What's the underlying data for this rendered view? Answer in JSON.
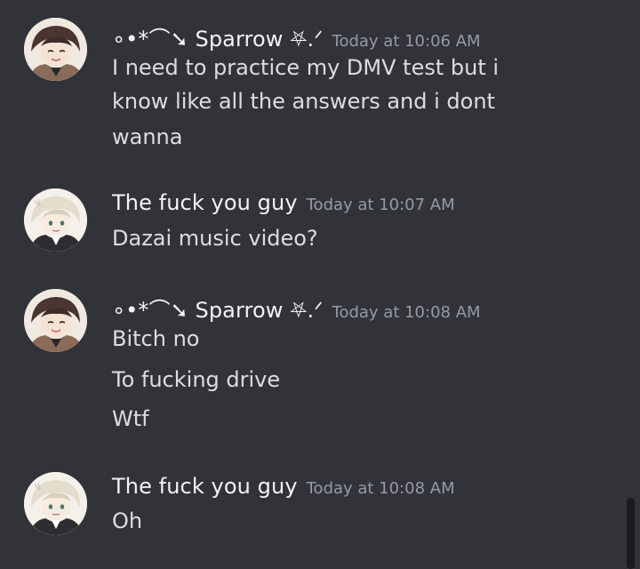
{
  "messages": [
    {
      "username": "∘•*⌒➘ Sparrow ⛧.ᐟ",
      "timestamp": "Today at 10:06 AM",
      "avatar_icon": "anime-avatar-brown-hair",
      "lines": [
        "I need to practice my DMV test but i",
        "know like all the answers and i dont",
        "wanna"
      ]
    },
    {
      "username": "The fuck you guy",
      "timestamp": "Today at 10:07 AM",
      "avatar_icon": "anime-avatar-light-hair",
      "lines": [
        "Dazai music video?"
      ]
    },
    {
      "username": "∘•*⌒➘ Sparrow ⛧.ᐟ",
      "timestamp": "Today at 10:08 AM",
      "avatar_icon": "anime-avatar-brown-hair",
      "lines": [
        "Bitch no",
        "To fucking drive",
        "Wtf"
      ]
    },
    {
      "username": "The fuck you guy",
      "timestamp": "Today at 10:08 AM",
      "avatar_icon": "anime-avatar-light-hair",
      "lines": [
        "Oh"
      ]
    }
  ],
  "colors": {
    "background": "#313338",
    "username": "#f2f3f5",
    "timestamp": "#949ba4",
    "message_text": "#dbdee1"
  }
}
